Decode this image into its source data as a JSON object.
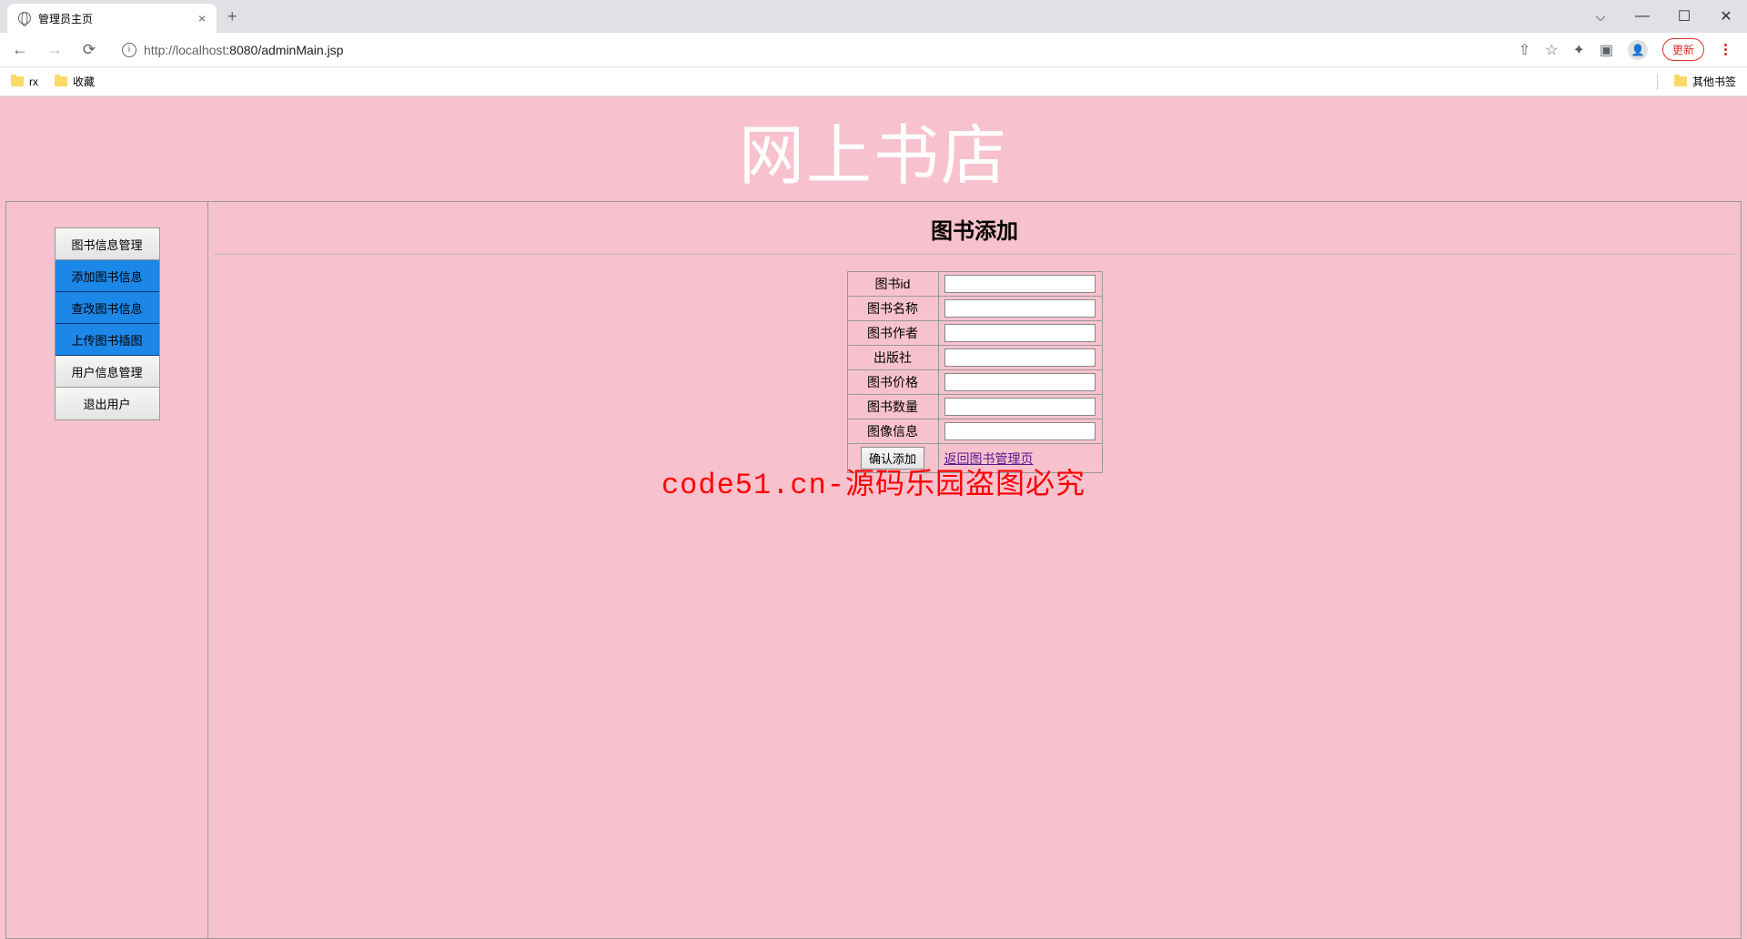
{
  "browser": {
    "tab_title": "管理员主页",
    "url_host": "http://localhost",
    "url_port_path": ":8080/adminMain.jsp",
    "update_label": "更新",
    "bookmarks": [
      {
        "label": "rx"
      },
      {
        "label": "收藏"
      }
    ],
    "other_bookmarks": "其他书签"
  },
  "page": {
    "banner_title": "网上书店",
    "sidebar": {
      "items": [
        {
          "label": "图书信息管理",
          "active": false
        },
        {
          "label": "添加图书信息",
          "active": true
        },
        {
          "label": "查改图书信息",
          "active": true
        },
        {
          "label": "上传图书插图",
          "active": true
        },
        {
          "label": "用户信息管理",
          "active": false
        },
        {
          "label": "退出用户",
          "active": false
        }
      ]
    },
    "main": {
      "heading": "图书添加",
      "form": {
        "fields": [
          {
            "label": "图书id",
            "value": ""
          },
          {
            "label": "图书名称",
            "value": ""
          },
          {
            "label": "图书作者",
            "value": ""
          },
          {
            "label": "出版社",
            "value": ""
          },
          {
            "label": "图书价格",
            "value": ""
          },
          {
            "label": "图书数量",
            "value": ""
          },
          {
            "label": "图像信息",
            "value": ""
          }
        ],
        "submit_label": "确认添加",
        "back_link_label": "返回图书管理页"
      }
    },
    "watermark": "code51.cn-源码乐园盗图必究"
  }
}
